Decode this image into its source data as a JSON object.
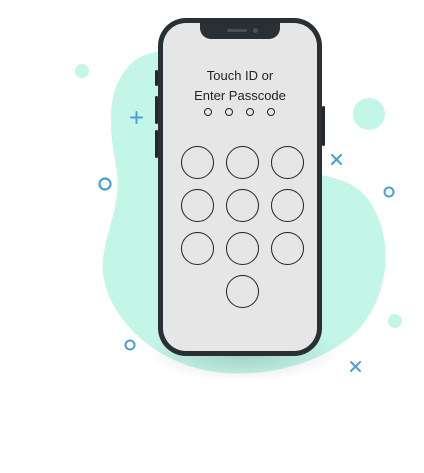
{
  "lock_screen": {
    "title_line1": "Touch ID or",
    "title_line2": "Enter Passcode",
    "passcode_length": 4,
    "keypad_keys": 10
  },
  "colors": {
    "blob": "#c3f6e6",
    "accent_blue": "#4a9fd8",
    "phone_frame": "#2a2f34",
    "screen": "#e6e6e6",
    "outline": "#222222"
  },
  "icons": [
    "plus-icon",
    "ring-icon",
    "cross-icon",
    "mint-circle"
  ]
}
